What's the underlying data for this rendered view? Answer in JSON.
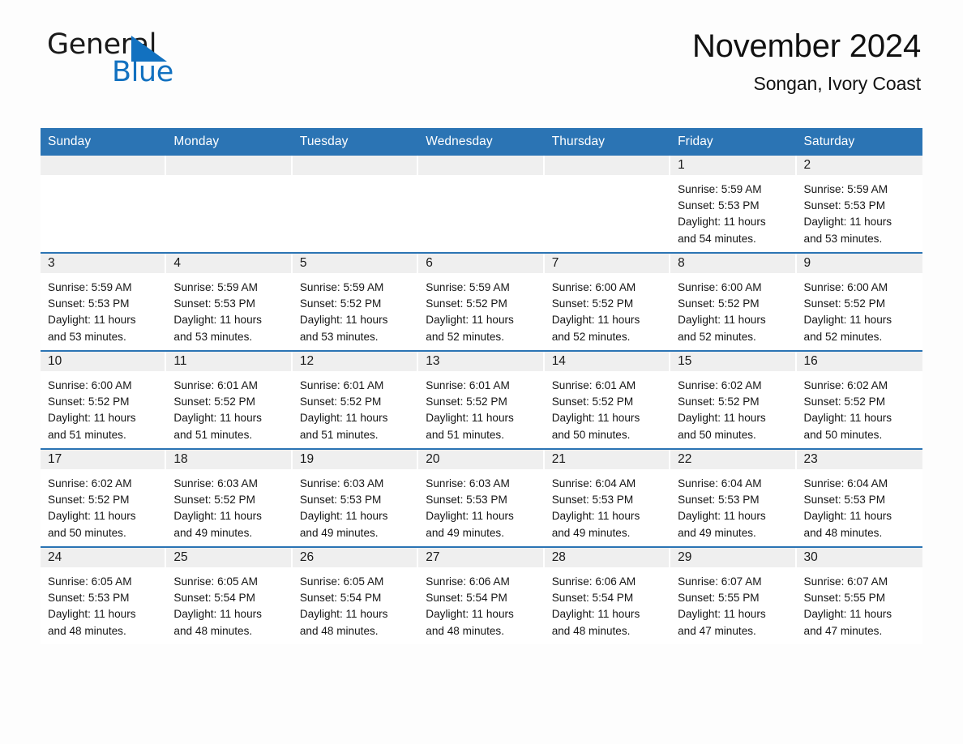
{
  "brand": {
    "name_part1": "General",
    "name_part2": "Blue",
    "accent_color": "#1271c0"
  },
  "header": {
    "month_title": "November 2024",
    "location": "Songan, Ivory Coast",
    "header_bg_color": "#2b74b4"
  },
  "weekday_headers": [
    "Sunday",
    "Monday",
    "Tuesday",
    "Wednesday",
    "Thursday",
    "Friday",
    "Saturday"
  ],
  "weeks": [
    [
      {
        "day": "",
        "sunrise": "",
        "sunset": "",
        "daylight_line1": "",
        "daylight_line2": ""
      },
      {
        "day": "",
        "sunrise": "",
        "sunset": "",
        "daylight_line1": "",
        "daylight_line2": ""
      },
      {
        "day": "",
        "sunrise": "",
        "sunset": "",
        "daylight_line1": "",
        "daylight_line2": ""
      },
      {
        "day": "",
        "sunrise": "",
        "sunset": "",
        "daylight_line1": "",
        "daylight_line2": ""
      },
      {
        "day": "",
        "sunrise": "",
        "sunset": "",
        "daylight_line1": "",
        "daylight_line2": ""
      },
      {
        "day": "1",
        "sunrise": "Sunrise: 5:59 AM",
        "sunset": "Sunset: 5:53 PM",
        "daylight_line1": "Daylight: 11 hours",
        "daylight_line2": "and 54 minutes."
      },
      {
        "day": "2",
        "sunrise": "Sunrise: 5:59 AM",
        "sunset": "Sunset: 5:53 PM",
        "daylight_line1": "Daylight: 11 hours",
        "daylight_line2": "and 53 minutes."
      }
    ],
    [
      {
        "day": "3",
        "sunrise": "Sunrise: 5:59 AM",
        "sunset": "Sunset: 5:53 PM",
        "daylight_line1": "Daylight: 11 hours",
        "daylight_line2": "and 53 minutes."
      },
      {
        "day": "4",
        "sunrise": "Sunrise: 5:59 AM",
        "sunset": "Sunset: 5:53 PM",
        "daylight_line1": "Daylight: 11 hours",
        "daylight_line2": "and 53 minutes."
      },
      {
        "day": "5",
        "sunrise": "Sunrise: 5:59 AM",
        "sunset": "Sunset: 5:52 PM",
        "daylight_line1": "Daylight: 11 hours",
        "daylight_line2": "and 53 minutes."
      },
      {
        "day": "6",
        "sunrise": "Sunrise: 5:59 AM",
        "sunset": "Sunset: 5:52 PM",
        "daylight_line1": "Daylight: 11 hours",
        "daylight_line2": "and 52 minutes."
      },
      {
        "day": "7",
        "sunrise": "Sunrise: 6:00 AM",
        "sunset": "Sunset: 5:52 PM",
        "daylight_line1": "Daylight: 11 hours",
        "daylight_line2": "and 52 minutes."
      },
      {
        "day": "8",
        "sunrise": "Sunrise: 6:00 AM",
        "sunset": "Sunset: 5:52 PM",
        "daylight_line1": "Daylight: 11 hours",
        "daylight_line2": "and 52 minutes."
      },
      {
        "day": "9",
        "sunrise": "Sunrise: 6:00 AM",
        "sunset": "Sunset: 5:52 PM",
        "daylight_line1": "Daylight: 11 hours",
        "daylight_line2": "and 52 minutes."
      }
    ],
    [
      {
        "day": "10",
        "sunrise": "Sunrise: 6:00 AM",
        "sunset": "Sunset: 5:52 PM",
        "daylight_line1": "Daylight: 11 hours",
        "daylight_line2": "and 51 minutes."
      },
      {
        "day": "11",
        "sunrise": "Sunrise: 6:01 AM",
        "sunset": "Sunset: 5:52 PM",
        "daylight_line1": "Daylight: 11 hours",
        "daylight_line2": "and 51 minutes."
      },
      {
        "day": "12",
        "sunrise": "Sunrise: 6:01 AM",
        "sunset": "Sunset: 5:52 PM",
        "daylight_line1": "Daylight: 11 hours",
        "daylight_line2": "and 51 minutes."
      },
      {
        "day": "13",
        "sunrise": "Sunrise: 6:01 AM",
        "sunset": "Sunset: 5:52 PM",
        "daylight_line1": "Daylight: 11 hours",
        "daylight_line2": "and 51 minutes."
      },
      {
        "day": "14",
        "sunrise": "Sunrise: 6:01 AM",
        "sunset": "Sunset: 5:52 PM",
        "daylight_line1": "Daylight: 11 hours",
        "daylight_line2": "and 50 minutes."
      },
      {
        "day": "15",
        "sunrise": "Sunrise: 6:02 AM",
        "sunset": "Sunset: 5:52 PM",
        "daylight_line1": "Daylight: 11 hours",
        "daylight_line2": "and 50 minutes."
      },
      {
        "day": "16",
        "sunrise": "Sunrise: 6:02 AM",
        "sunset": "Sunset: 5:52 PM",
        "daylight_line1": "Daylight: 11 hours",
        "daylight_line2": "and 50 minutes."
      }
    ],
    [
      {
        "day": "17",
        "sunrise": "Sunrise: 6:02 AM",
        "sunset": "Sunset: 5:52 PM",
        "daylight_line1": "Daylight: 11 hours",
        "daylight_line2": "and 50 minutes."
      },
      {
        "day": "18",
        "sunrise": "Sunrise: 6:03 AM",
        "sunset": "Sunset: 5:52 PM",
        "daylight_line1": "Daylight: 11 hours",
        "daylight_line2": "and 49 minutes."
      },
      {
        "day": "19",
        "sunrise": "Sunrise: 6:03 AM",
        "sunset": "Sunset: 5:53 PM",
        "daylight_line1": "Daylight: 11 hours",
        "daylight_line2": "and 49 minutes."
      },
      {
        "day": "20",
        "sunrise": "Sunrise: 6:03 AM",
        "sunset": "Sunset: 5:53 PM",
        "daylight_line1": "Daylight: 11 hours",
        "daylight_line2": "and 49 minutes."
      },
      {
        "day": "21",
        "sunrise": "Sunrise: 6:04 AM",
        "sunset": "Sunset: 5:53 PM",
        "daylight_line1": "Daylight: 11 hours",
        "daylight_line2": "and 49 minutes."
      },
      {
        "day": "22",
        "sunrise": "Sunrise: 6:04 AM",
        "sunset": "Sunset: 5:53 PM",
        "daylight_line1": "Daylight: 11 hours",
        "daylight_line2": "and 49 minutes."
      },
      {
        "day": "23",
        "sunrise": "Sunrise: 6:04 AM",
        "sunset": "Sunset: 5:53 PM",
        "daylight_line1": "Daylight: 11 hours",
        "daylight_line2": "and 48 minutes."
      }
    ],
    [
      {
        "day": "24",
        "sunrise": "Sunrise: 6:05 AM",
        "sunset": "Sunset: 5:53 PM",
        "daylight_line1": "Daylight: 11 hours",
        "daylight_line2": "and 48 minutes."
      },
      {
        "day": "25",
        "sunrise": "Sunrise: 6:05 AM",
        "sunset": "Sunset: 5:54 PM",
        "daylight_line1": "Daylight: 11 hours",
        "daylight_line2": "and 48 minutes."
      },
      {
        "day": "26",
        "sunrise": "Sunrise: 6:05 AM",
        "sunset": "Sunset: 5:54 PM",
        "daylight_line1": "Daylight: 11 hours",
        "daylight_line2": "and 48 minutes."
      },
      {
        "day": "27",
        "sunrise": "Sunrise: 6:06 AM",
        "sunset": "Sunset: 5:54 PM",
        "daylight_line1": "Daylight: 11 hours",
        "daylight_line2": "and 48 minutes."
      },
      {
        "day": "28",
        "sunrise": "Sunrise: 6:06 AM",
        "sunset": "Sunset: 5:54 PM",
        "daylight_line1": "Daylight: 11 hours",
        "daylight_line2": "and 48 minutes."
      },
      {
        "day": "29",
        "sunrise": "Sunrise: 6:07 AM",
        "sunset": "Sunset: 5:55 PM",
        "daylight_line1": "Daylight: 11 hours",
        "daylight_line2": "and 47 minutes."
      },
      {
        "day": "30",
        "sunrise": "Sunrise: 6:07 AM",
        "sunset": "Sunset: 5:55 PM",
        "daylight_line1": "Daylight: 11 hours",
        "daylight_line2": "and 47 minutes."
      }
    ]
  ]
}
